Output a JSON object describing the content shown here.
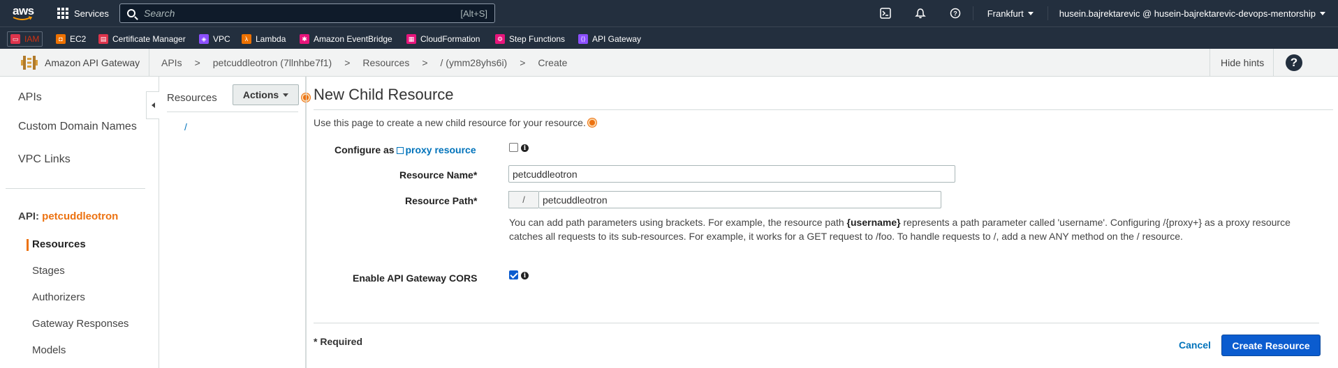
{
  "topbar": {
    "logo_text": "aws",
    "services_label": "Services",
    "search_placeholder": "Search",
    "search_shortcut": "[Alt+S]",
    "region": "Frankfurt",
    "account": "husein.bajrektarevic @ husein-bajrektarevic-devops-mentorship"
  },
  "favorites": [
    {
      "label": "IAM",
      "color": "#dd344c",
      "icon": "iam-icon"
    },
    {
      "label": "EC2",
      "color": "#ed7100",
      "icon": "ec2-icon"
    },
    {
      "label": "Certificate Manager",
      "color": "#dd344c",
      "icon": "certificate-manager-icon"
    },
    {
      "label": "VPC",
      "color": "#8c4fff",
      "icon": "vpc-icon"
    },
    {
      "label": "Lambda",
      "color": "#ed7100",
      "icon": "lambda-icon"
    },
    {
      "label": "Amazon EventBridge",
      "color": "#e7157b",
      "icon": "eventbridge-icon"
    },
    {
      "label": "CloudFormation",
      "color": "#e7157b",
      "icon": "cloudformation-icon"
    },
    {
      "label": "Step Functions",
      "color": "#e7157b",
      "icon": "step-functions-icon"
    },
    {
      "label": "API Gateway",
      "color": "#8c4fff",
      "icon": "api-gateway-icon"
    }
  ],
  "subnav": {
    "service_title": "Amazon API Gateway",
    "breadcrumbs": [
      "APIs",
      ">",
      "petcuddleotron (7llnhbe7f1)",
      ">",
      "Resources",
      ">",
      "/ (ymm28yhs6i)",
      ">",
      "Create"
    ],
    "hide_hints": "Hide hints",
    "help": "?"
  },
  "leftnav": {
    "items": [
      "APIs",
      "Custom Domain Names",
      "VPC Links"
    ],
    "api_prefix": "API:",
    "api_name": "petcuddleotron",
    "sub_items": [
      "Resources",
      "Stages",
      "Authorizers",
      "Gateway Responses",
      "Models"
    ]
  },
  "resources_panel": {
    "title": "Resources",
    "actions_label": "Actions",
    "root": "/"
  },
  "form": {
    "title": "New Child Resource",
    "intro": "Use this page to create a new child resource for your resource.",
    "proxy_label_prefix": "Configure as",
    "proxy_label_link": "proxy resource",
    "proxy_checked": false,
    "name_label": "Resource Name*",
    "name_value": "petcuddleotron",
    "path_label": "Resource Path*",
    "path_prefix": "/",
    "path_value": "petcuddleotron",
    "help_part1": "You can add path parameters using brackets. For example, the resource path ",
    "help_bold": "{username}",
    "help_part2": " represents a path parameter called 'username'. Configuring /{proxy+} as a proxy resource catches all requests to its sub-resources. For example, it works for a GET request to /foo. To handle requests to /, add a new ANY method on the / resource.",
    "cors_label": "Enable API Gateway CORS",
    "cors_checked": true,
    "required_note": "* Required",
    "cancel_label": "Cancel",
    "create_label": "Create Resource"
  },
  "colors": {
    "topbar_bg": "#232f3e",
    "accent_orange": "#ec7211",
    "link_blue": "#0073bb",
    "primary_button": "#0b5ccf"
  }
}
